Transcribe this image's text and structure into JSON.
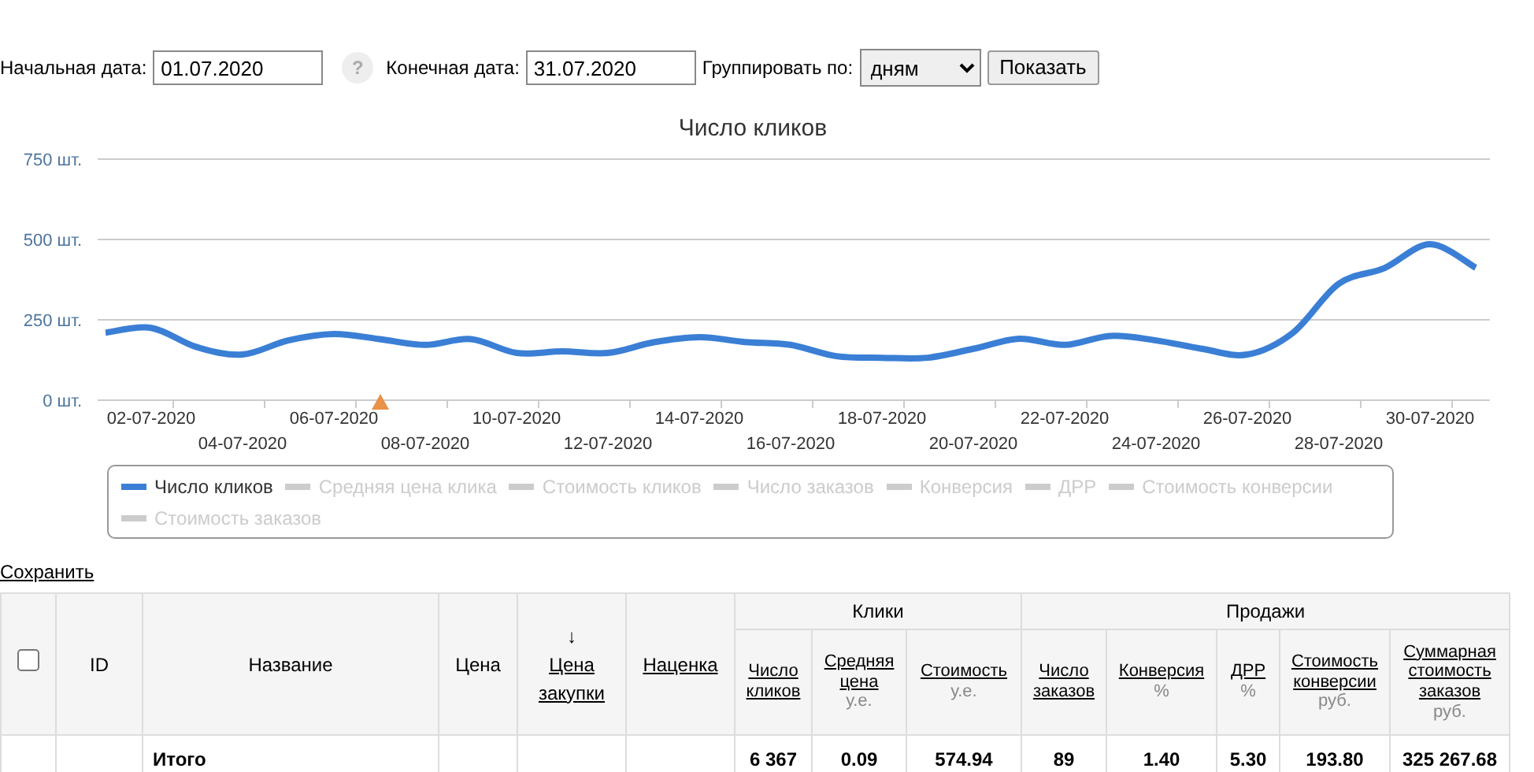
{
  "filter": {
    "start_label": "Начальная дата:",
    "start_value": "01.07.2020",
    "help": "?",
    "end_label": "Конечная дата:",
    "end_value": "31.07.2020",
    "group_label": "Группировать по:",
    "group_value": "дням",
    "submit": "Показать"
  },
  "chart": {
    "chart_data": {
      "type": "line",
      "title": "Число кликов",
      "categories": [
        null,
        "02-07-2020",
        null,
        "04-07-2020",
        null,
        "06-07-2020",
        null,
        "08-07-2020",
        null,
        "10-07-2020",
        null,
        "12-07-2020",
        null,
        "14-07-2020",
        null,
        "16-07-2020",
        null,
        "18-07-2020",
        null,
        "20-07-2020",
        null,
        "22-07-2020",
        null,
        "24-07-2020",
        null,
        "26-07-2020",
        null,
        "28-07-2020",
        null,
        "30-07-2020",
        null
      ],
      "ylim": [
        0,
        750
      ],
      "yticks": [
        {
          "value": 750,
          "label": "750 шт."
        },
        {
          "value": 500,
          "label": "500 шт."
        },
        {
          "value": 250,
          "label": "250 шт."
        },
        {
          "value": 0,
          "label": "0 шт."
        }
      ],
      "series": [
        {
          "color": "#3a7fd5",
          "values": [
            210,
            225,
            165,
            142,
            186,
            206,
            190,
            172,
            190,
            147,
            152,
            147,
            180,
            196,
            181,
            172,
            137,
            132,
            132,
            160,
            191,
            172,
            200,
            186,
            160,
            142,
            210,
            362,
            411,
            485,
            412
          ]
        }
      ]
    },
    "legend": [
      {
        "label": "Число кликов",
        "visible": true
      },
      {
        "label": "Средняя цена клика",
        "visible": false
      },
      {
        "label": "Стоимость кликов",
        "visible": false
      },
      {
        "label": "Число заказов",
        "visible": false
      },
      {
        "label": "Конверсия",
        "visible": false
      },
      {
        "label": "ДРР",
        "visible": false
      },
      {
        "label": "Стоимость конверсии",
        "visible": false
      },
      {
        "label": "Стоимость заказов",
        "visible": false
      }
    ]
  },
  "save_link": "Сохранить",
  "table": {
    "columns": [
      {
        "kind": "checkbox",
        "checked": false
      },
      {
        "kind": "text",
        "label": "ID"
      },
      {
        "kind": "text",
        "label": "Название",
        "total": "Итого"
      },
      {
        "kind": "text",
        "label": "Цена"
      },
      {
        "kind": "link",
        "sort_mark": "↓",
        "label": "Цена закупки"
      },
      {
        "kind": "link",
        "label": "Наценка"
      },
      {
        "kind": "group",
        "label": "Клики",
        "columns": [
          {
            "kind": "link",
            "label": "Число кликов",
            "total": "6 367"
          },
          {
            "kind": "link",
            "label": "Средняя цена",
            "unit": "у.е.",
            "total": "0.09"
          },
          {
            "kind": "link",
            "label": "Стоимость",
            "unit": "у.е.",
            "total": "574.94"
          }
        ]
      },
      {
        "kind": "group",
        "label": "Продажи",
        "columns": [
          {
            "kind": "link",
            "label": "Число заказов",
            "total": "89"
          },
          {
            "kind": "link",
            "label": "Конверсия",
            "unit": "%",
            "total": "1.40"
          },
          {
            "kind": "link",
            "label": "ДРР",
            "unit": "%",
            "total": "5.30"
          },
          {
            "kind": "link",
            "label": "Стоимость конверсии",
            "unit": "руб.",
            "total": "193.80"
          },
          {
            "kind": "link",
            "label": "Суммарная стоимость заказов",
            "unit": "руб.",
            "total": "325 267.68"
          }
        ]
      }
    ]
  }
}
